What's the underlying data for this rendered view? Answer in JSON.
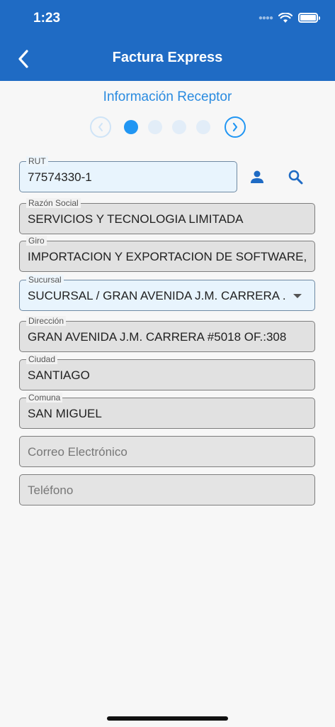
{
  "status_bar": {
    "time": "1:23"
  },
  "nav": {
    "title": "Factura Express",
    "back_icon": "chevron-left-icon"
  },
  "section": {
    "title": "Información Receptor"
  },
  "stepper": {
    "total_steps": 4,
    "current_step": 1
  },
  "actions": {
    "user_icon": "person-icon",
    "search_icon": "search-icon"
  },
  "form": {
    "rut": {
      "label": "RUT",
      "value": "77574330-1"
    },
    "razon_social": {
      "label": "Razón Social",
      "value": "SERVICIOS Y TECNOLOGIA LIMITADA"
    },
    "giro": {
      "label": "Giro",
      "value": "IMPORTACION Y EXPORTACION DE SOFTWARE, S"
    },
    "sucursal": {
      "label": "Sucursal",
      "value": "SUCURSAL / GRAN AVENIDA J.M. CARRERA ..."
    },
    "direccion": {
      "label": "Dirección",
      "value": "GRAN AVENIDA J.M. CARRERA #5018 OF.:308"
    },
    "ciudad": {
      "label": "Ciudad",
      "value": "SANTIAGO"
    },
    "comuna": {
      "label": "Comuna",
      "value": "SAN MIGUEL"
    },
    "correo": {
      "placeholder": "Correo Electrónico"
    },
    "telefono": {
      "placeholder": "Teléfono"
    }
  },
  "colors": {
    "header": "#1f6bc4",
    "accent": "#2196f3",
    "section_title": "#2a8be0"
  }
}
